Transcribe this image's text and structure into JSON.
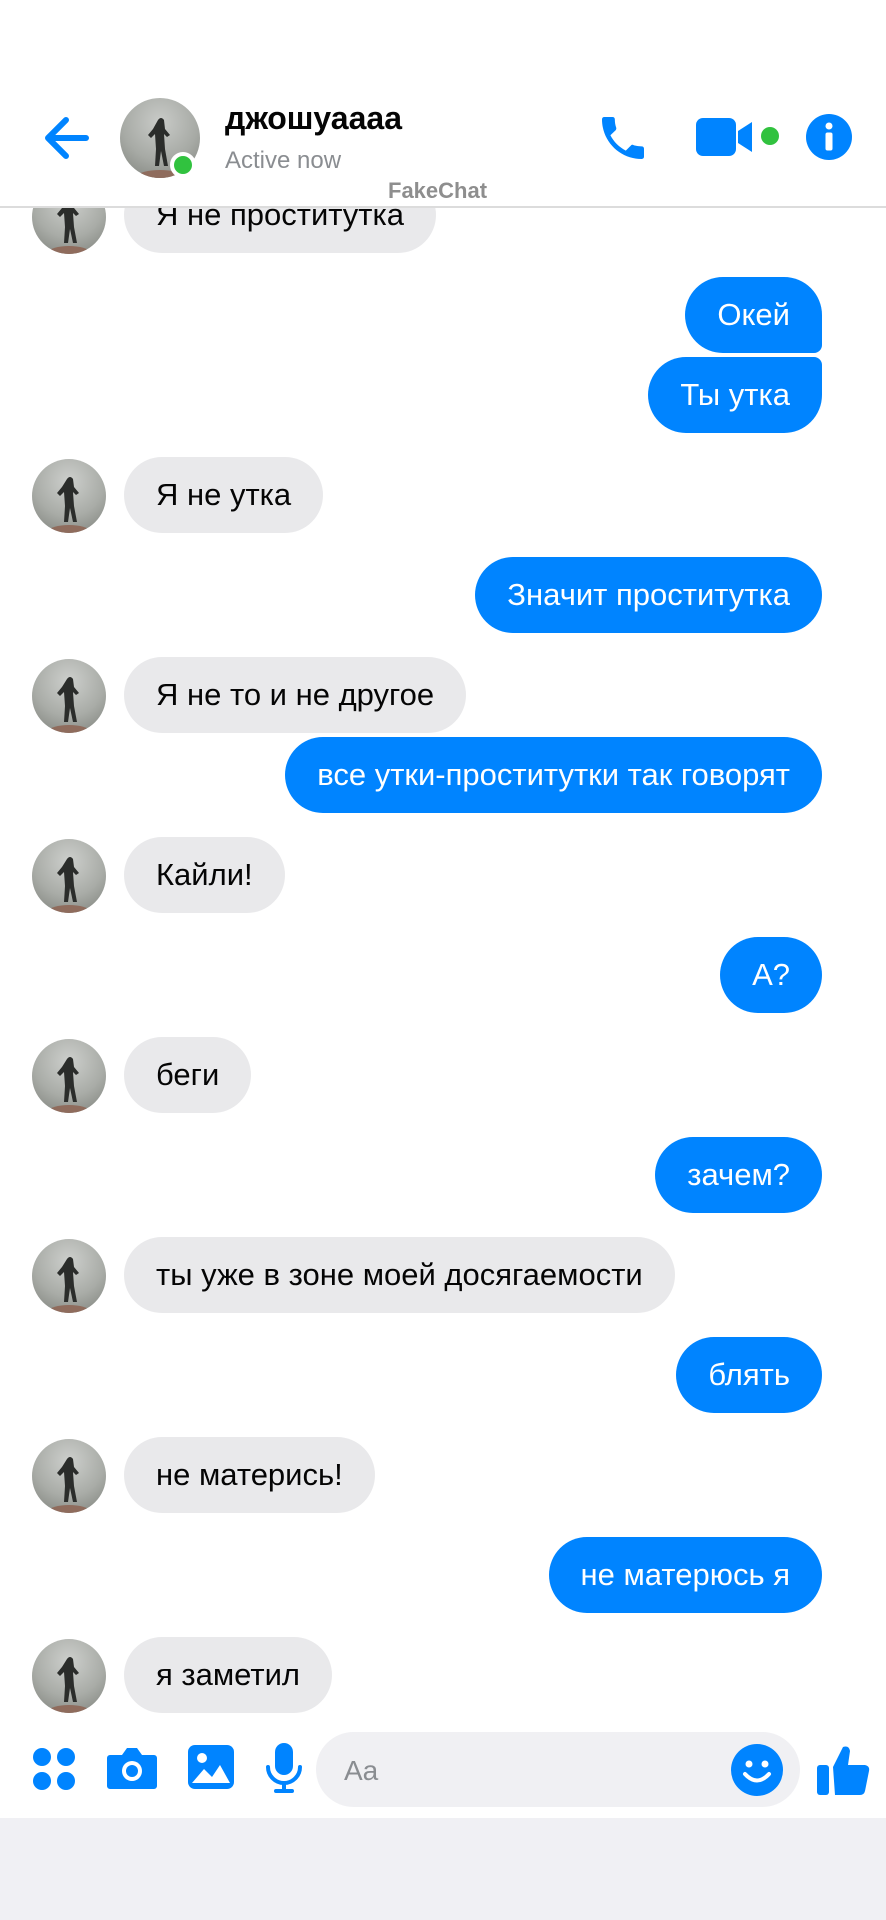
{
  "header": {
    "contact_name": "джошуаааа",
    "status": "Active now",
    "watermark": "FakeChat",
    "back_icon": "arrow-left-icon",
    "call_icon": "phone-icon",
    "video_icon": "video-camera-icon",
    "info_icon": "info-icon"
  },
  "messages": [
    {
      "side": "in",
      "text": "Я не проститутка"
    },
    {
      "side": "out",
      "text": "Окей"
    },
    {
      "side": "out",
      "text": "Ты утка"
    },
    {
      "side": "in",
      "text": "Я не утка"
    },
    {
      "side": "out",
      "text": "Значит проститутка"
    },
    {
      "side": "in",
      "text": "Я не то и не другое"
    },
    {
      "side": "out",
      "text": "все утки-проститутки так говорят"
    },
    {
      "side": "in",
      "text": "Кайли!"
    },
    {
      "side": "out",
      "text": "А?"
    },
    {
      "side": "in",
      "text": "беги"
    },
    {
      "side": "out",
      "text": "зачем?"
    },
    {
      "side": "in",
      "text": "ты уже в зоне моей досягаемости"
    },
    {
      "side": "out",
      "text": "блять"
    },
    {
      "side": "in",
      "text": "не матерись!"
    },
    {
      "side": "out",
      "text": "не матерюсь я"
    },
    {
      "side": "in",
      "text": "я заметил"
    }
  ],
  "composer": {
    "placeholder": "Aa",
    "icons": [
      "apps-grid-icon",
      "camera-icon",
      "image-icon",
      "microphone-icon",
      "emoji-icon",
      "thumbs-up-icon"
    ]
  },
  "colors": {
    "accent": "#0084ff",
    "incoming_bubble": "#e9e9eb",
    "online": "#31c23f"
  }
}
